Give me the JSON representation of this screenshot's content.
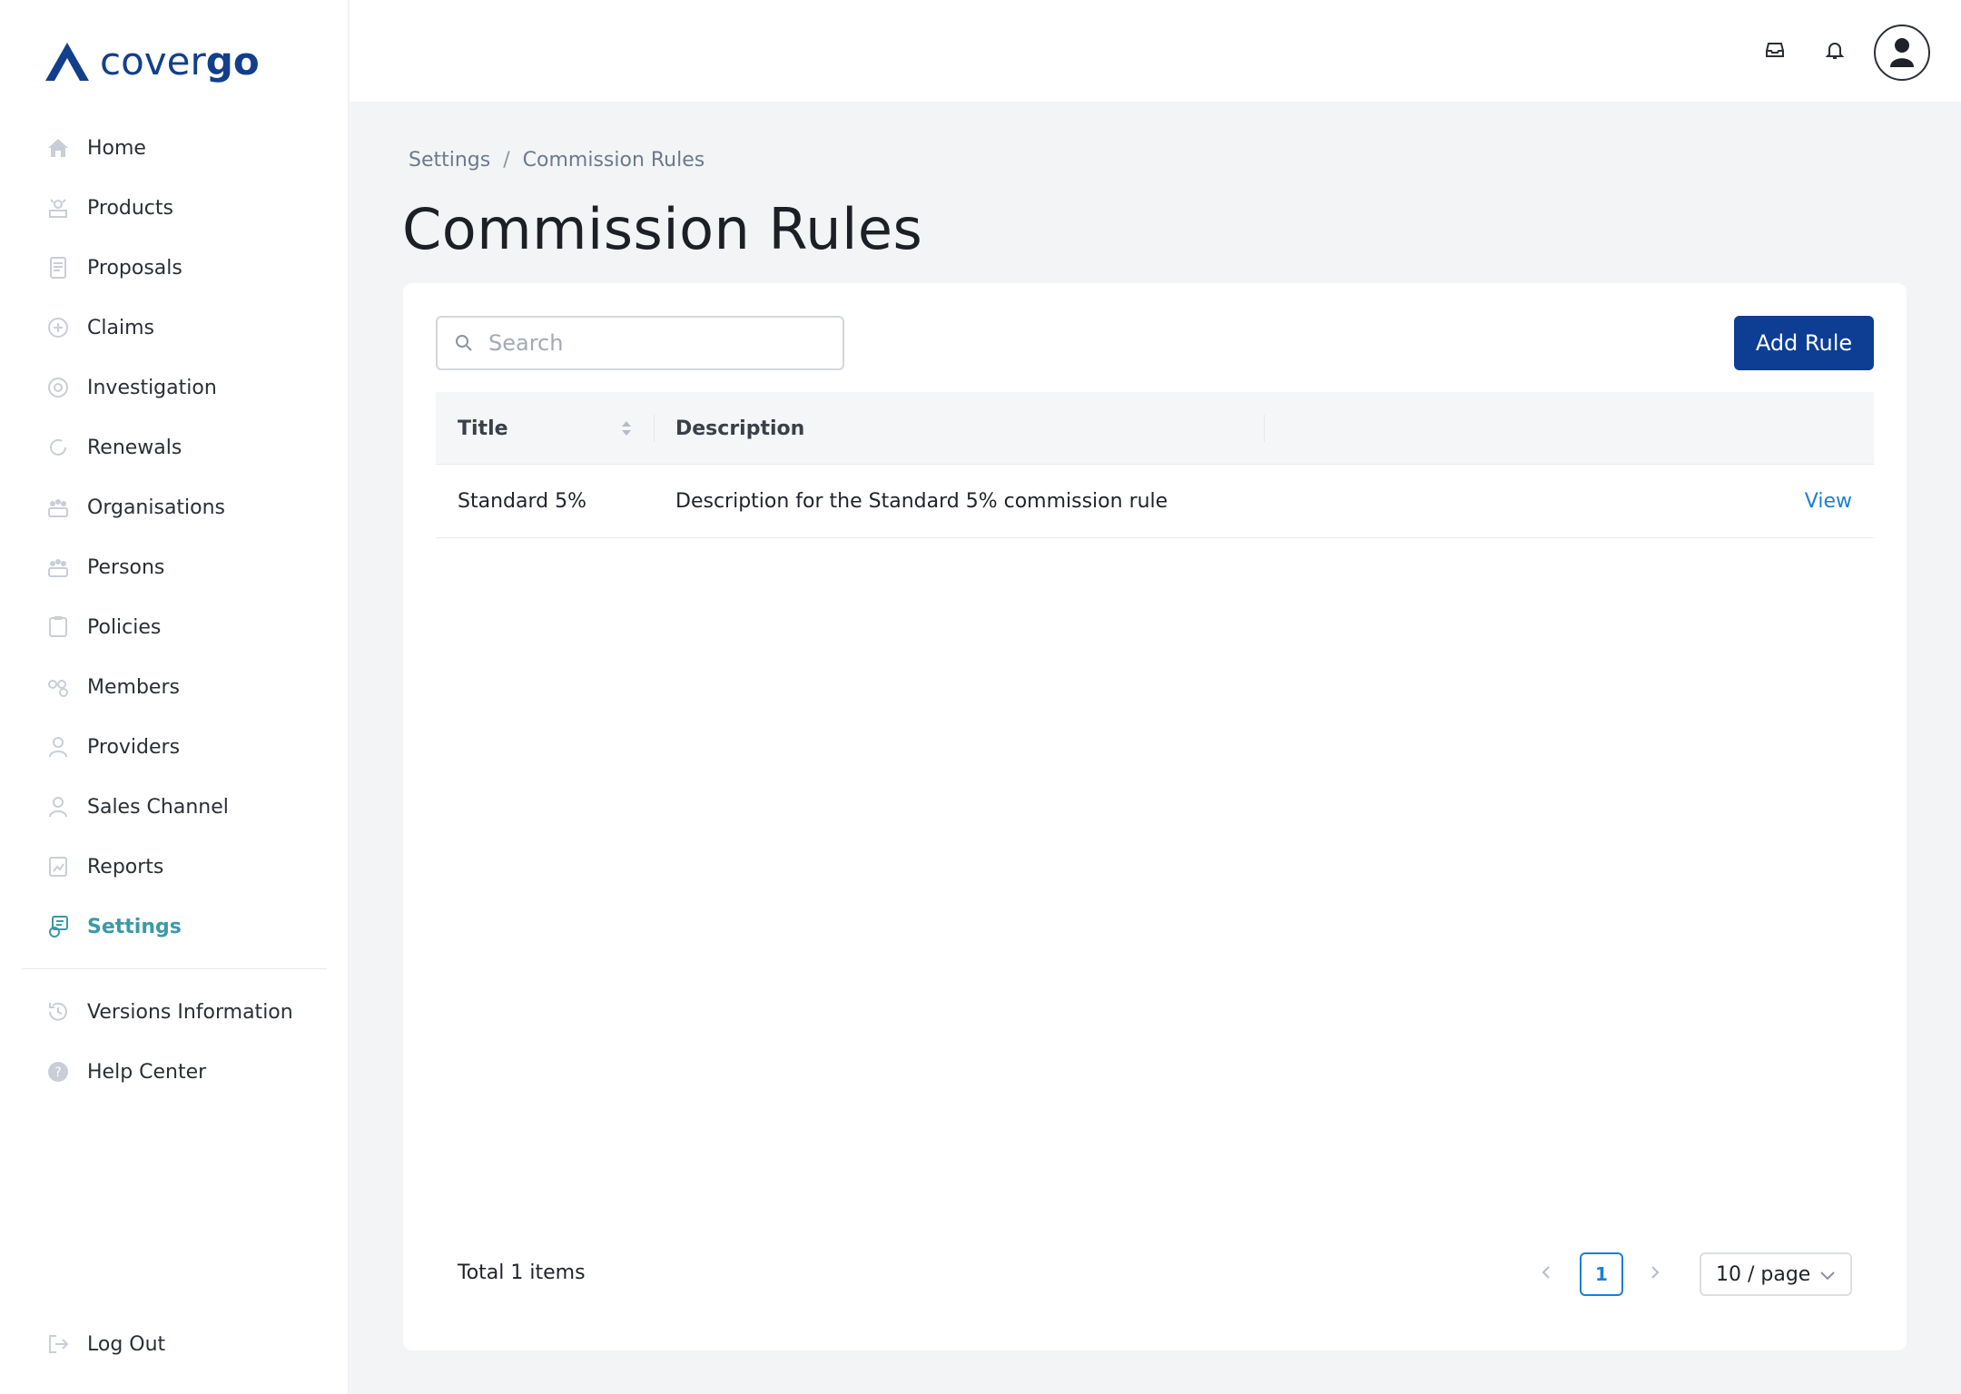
{
  "brand": {
    "name_light": "cover",
    "name_bold": "go",
    "color": "#123f8c"
  },
  "sidebar": {
    "items": [
      {
        "label": "Home",
        "icon": "home-icon"
      },
      {
        "label": "Products",
        "icon": "products-icon"
      },
      {
        "label": "Proposals",
        "icon": "proposals-icon"
      },
      {
        "label": "Claims",
        "icon": "claims-icon"
      },
      {
        "label": "Investigation",
        "icon": "investigation-icon"
      },
      {
        "label": "Renewals",
        "icon": "renewals-icon"
      },
      {
        "label": "Organisations",
        "icon": "organisations-icon"
      },
      {
        "label": "Persons",
        "icon": "persons-icon"
      },
      {
        "label": "Policies",
        "icon": "policies-icon"
      },
      {
        "label": "Members",
        "icon": "members-icon"
      },
      {
        "label": "Providers",
        "icon": "providers-icon"
      },
      {
        "label": "Sales Channel",
        "icon": "sales-channel-icon"
      },
      {
        "label": "Reports",
        "icon": "reports-icon"
      },
      {
        "label": "Settings",
        "icon": "settings-icon",
        "active": true
      }
    ],
    "secondary": [
      {
        "label": "Versions Information",
        "icon": "history-icon"
      },
      {
        "label": "Help Center",
        "icon": "help-icon"
      }
    ],
    "logout": {
      "label": "Log Out",
      "icon": "logout-icon"
    },
    "active_color": "#3a9aa6"
  },
  "topbar": {
    "icons": [
      "inbox-icon",
      "bell-icon",
      "avatar-icon"
    ]
  },
  "breadcrumb": {
    "items": [
      "Settings",
      "Commission Rules"
    ],
    "separator": "/"
  },
  "page": {
    "title": "Commission Rules"
  },
  "toolbar": {
    "search_placeholder": "Search",
    "add_label": "Add Rule",
    "accent": "#0d3e94"
  },
  "table": {
    "columns": [
      "Title",
      "Description",
      ""
    ],
    "rows": [
      {
        "title": "Standard 5%",
        "description": "Description for the Standard 5% commission rule",
        "action": "View"
      }
    ],
    "link_color": "#1d7ed2"
  },
  "pagination": {
    "total_text": "Total 1 items",
    "current_page": "1",
    "page_size": "10 / page"
  }
}
